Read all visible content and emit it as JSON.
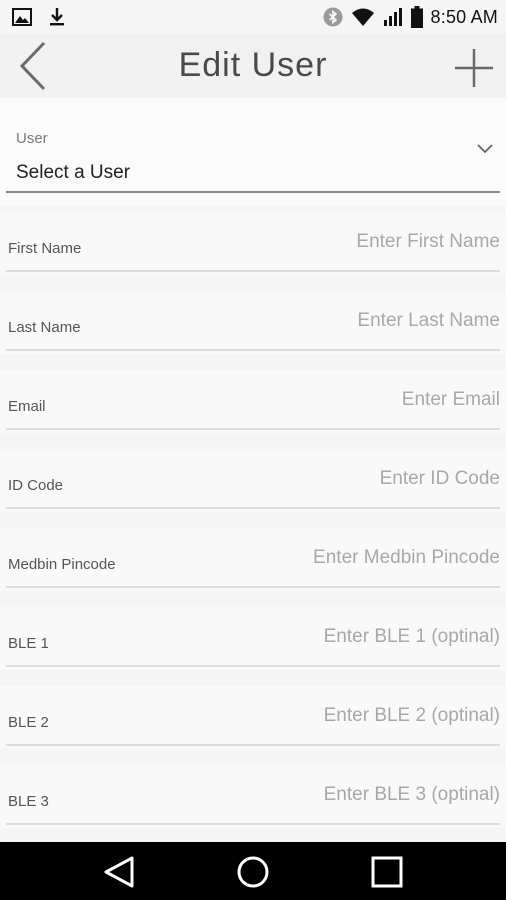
{
  "status_bar": {
    "time": "8:50 AM",
    "icons_left": [
      "image-icon",
      "download-icon"
    ],
    "icons_right": [
      "bluetooth-icon",
      "wifi-icon",
      "signal-icon",
      "battery-icon"
    ]
  },
  "app_bar": {
    "title": "Edit User",
    "back_icon": "chevron-left-icon",
    "add_icon": "plus-icon"
  },
  "user_select": {
    "label": "User",
    "value": "Select a User"
  },
  "fields": [
    {
      "label": "First Name",
      "placeholder": "Enter First Name"
    },
    {
      "label": "Last Name",
      "placeholder": "Enter Last Name"
    },
    {
      "label": "Email",
      "placeholder": "Enter Email"
    },
    {
      "label": "ID Code",
      "placeholder": "Enter ID Code"
    },
    {
      "label": "Medbin Pincode",
      "placeholder": "Enter Medbin Pincode"
    },
    {
      "label": "BLE 1",
      "placeholder": "Enter BLE 1 (optinal)"
    },
    {
      "label": "BLE 2",
      "placeholder": "Enter BLE 2 (optinal)"
    },
    {
      "label": "BLE 3",
      "placeholder": "Enter BLE 3 (optinal)"
    }
  ],
  "nav_bar": {
    "icons": [
      "back-triangle-icon",
      "home-circle-icon",
      "recents-square-icon"
    ]
  },
  "colors": {
    "background": "#f5f5f5",
    "title_text": "#4a4a4a",
    "placeholder_text": "#a8a8a8",
    "nav_bar": "#000000"
  }
}
